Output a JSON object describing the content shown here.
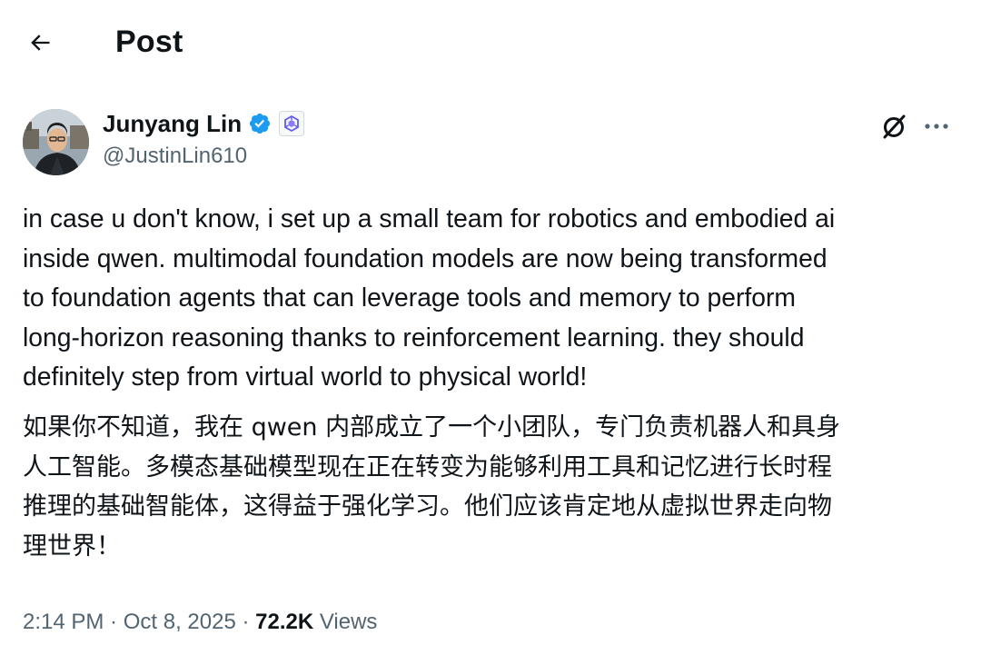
{
  "header": {
    "title": "Post",
    "back_icon": "arrow-left-icon"
  },
  "author": {
    "display_name": "Junyang Lin",
    "handle": "@JustinLin610",
    "verified_icon": "verified-badge-icon",
    "affiliation_icon": "qwen-affiliation-icon",
    "verified_color": "#1d9bf0"
  },
  "actions": {
    "grok_icon": "grok-icon",
    "more_icon": "more-horizontal-icon"
  },
  "tweet": {
    "lines_en": [
      "in case u don't know, i set up a small team for robotics and embodied ai",
      "inside qwen. multimodal foundation models are now being transformed",
      "to foundation agents that can leverage tools and memory to perform",
      "long-horizon reasoning thanks to reinforcement learning. they should",
      "definitely step from virtual world to physical world!"
    ],
    "lines_zh": [
      "如果你不知道，我在 qwen 内部成立了一个小团队，专门负责机器人和具身",
      "人工智能。多模态基础模型现在正在转变为能够利用工具和记忆进行长时程",
      "推理的基础智能体，这得益于强化学习。他们应该肯定地从虚拟世界走向物",
      "理世界！"
    ]
  },
  "meta": {
    "time": "2:14 PM",
    "separator": " · ",
    "date": "Oct 8, 2025",
    "views_count": "72.2K",
    "views_label": "Views"
  }
}
